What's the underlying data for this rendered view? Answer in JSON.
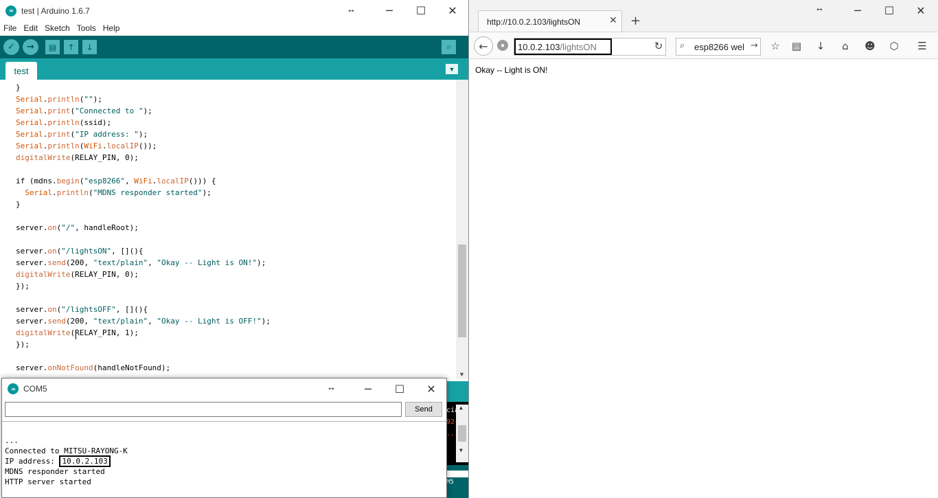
{
  "ide": {
    "title": "test | Arduino 1.6.7",
    "menu": [
      "File",
      "Edit",
      "Sketch",
      "Tools",
      "Help"
    ],
    "tab": "test",
    "code": [
      {
        "t": "}"
      },
      {
        "t": "Serial.println(\"\");"
      },
      {
        "t": "Serial.print(\"Connected to \");"
      },
      {
        "t": "Serial.println(ssid);"
      },
      {
        "t": "Serial.print(\"IP address: \");"
      },
      {
        "t": "Serial.println(WiFi.localIP());"
      },
      {
        "t": "digitalWrite(RELAY_PIN, 0);"
      },
      {
        "t": ""
      },
      {
        "t": "if (mdns.begin(\"esp8266\", WiFi.localIP())) {"
      },
      {
        "t": "  Serial.println(\"MDNS responder started\");"
      },
      {
        "t": "}"
      },
      {
        "t": ""
      },
      {
        "t": "server.on(\"/\", handleRoot);"
      },
      {
        "t": ""
      },
      {
        "t": "server.on(\"/lightsON\", [](){"
      },
      {
        "t": "server.send(200, \"text/plain\", \"Okay -- Light is ON!\");"
      },
      {
        "t": "digitalWrite(RELAY_PIN, 0);"
      },
      {
        "t": "});"
      },
      {
        "t": ""
      },
      {
        "t": "server.on(\"/lightsOFF\", [](){"
      },
      {
        "t": "server.send(200, \"text/plain\", \"Okay -- Light is OFF!\");"
      },
      {
        "t": "digitalWrite(RELAY_PIN, 1);"
      },
      {
        "t": "});"
      },
      {
        "t": ""
      },
      {
        "t": "server.onNotFound(handleNotFound);"
      }
    ],
    "console_fragments": [
      "cia",
      "92",
      "..."
    ],
    "status_fragment": "M5"
  },
  "serial": {
    "title": "COM5",
    "input_value": "",
    "send_label": "Send",
    "output": [
      {
        "text": "..."
      },
      {
        "text": "Connected to MITSU-RAYONG-K"
      },
      {
        "prefix": "IP address: ",
        "value": "10.0.2.103"
      },
      {
        "text": "MDNS responder started"
      },
      {
        "text": "HTTP server started"
      }
    ]
  },
  "browser": {
    "tab_title": "http://10.0.2.103/lightsON",
    "url_host": "10.0.2.103",
    "url_path": "/lightsON",
    "search_value": "esp8266 wel",
    "page_text": "Okay -- Light is ON!"
  },
  "colors": {
    "arduino_dark": "#006468",
    "arduino_teal": "#17a1a5",
    "keyword": "#d35400",
    "string": "#005c5f"
  }
}
